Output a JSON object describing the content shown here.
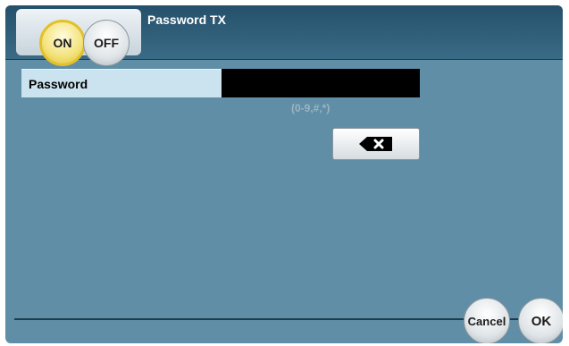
{
  "header": {
    "title": "Password TX",
    "on_label": "ON",
    "off_label": "OFF",
    "selected": "ON"
  },
  "password_field": {
    "label": "Password",
    "value": "",
    "hint": "(0-9,#,*)"
  },
  "backspace": {
    "icon": "backspace-icon"
  },
  "footer": {
    "cancel_label": "Cancel",
    "ok_label": "OK"
  },
  "colors": {
    "screen_bg": "#5f8ea6",
    "title_bar": "#25506a",
    "on_highlight": "#e2c02a",
    "field_label_bg": "#cbe3ee",
    "field_value_bg": "#000000"
  }
}
